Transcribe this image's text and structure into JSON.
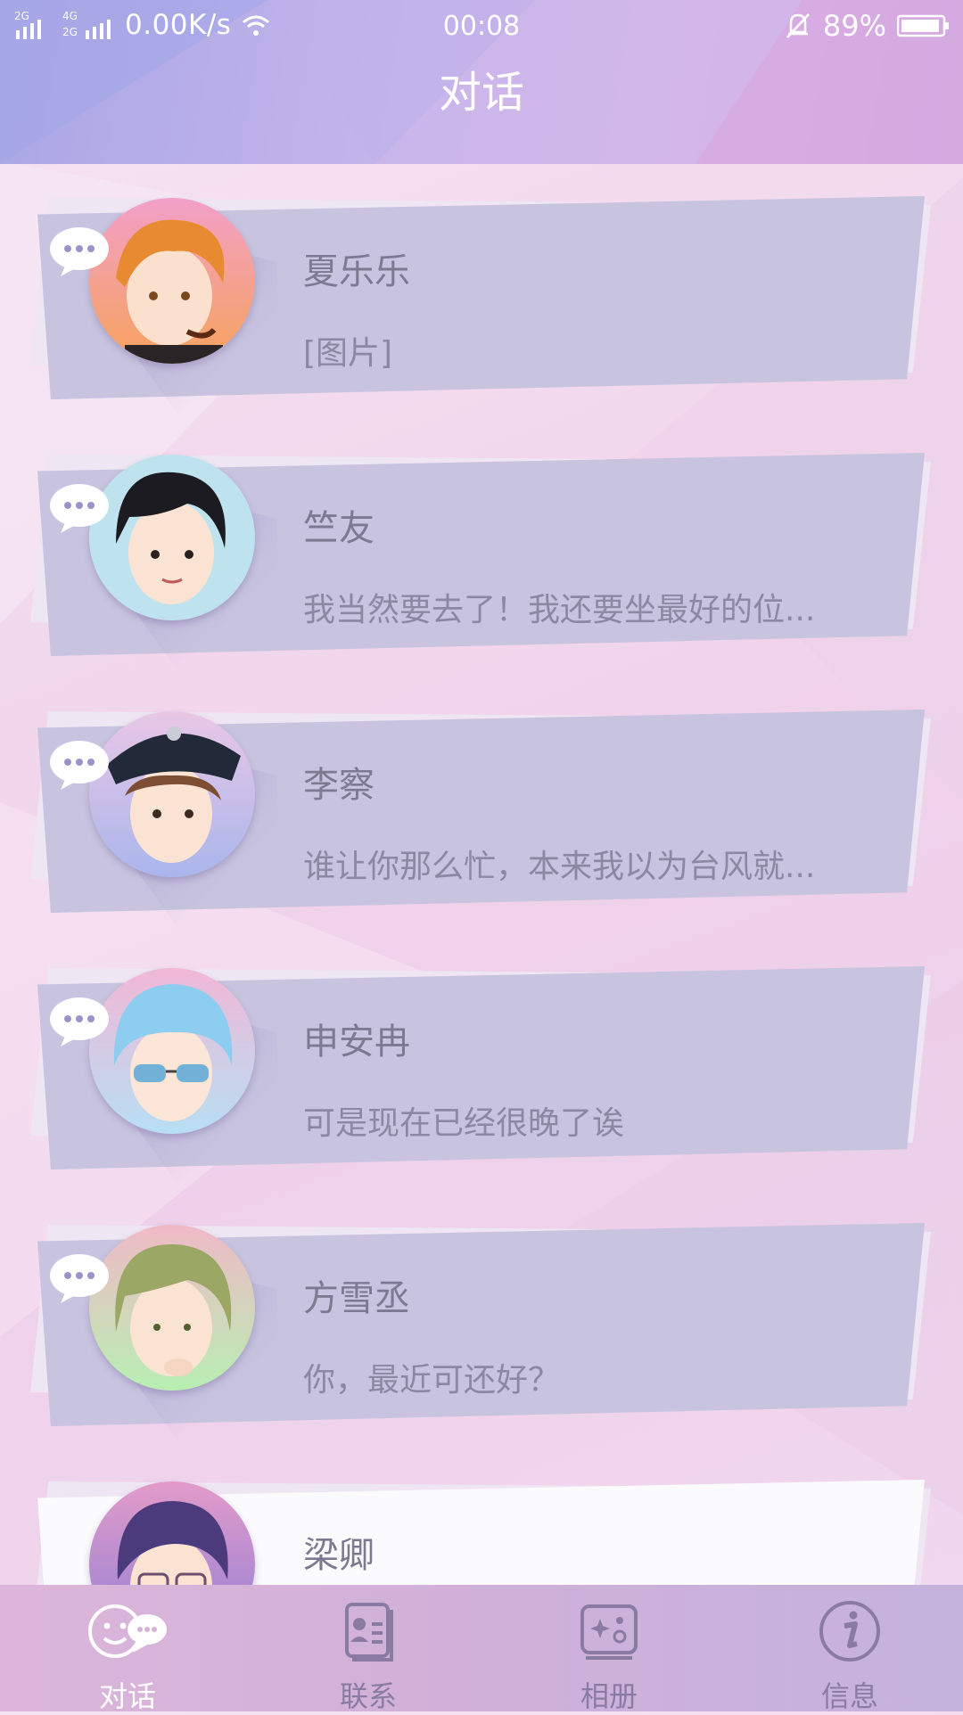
{
  "status_bar": {
    "network": "2G 4G",
    "speed": "0.00K/s",
    "time": "00:08",
    "battery": "89%",
    "icons": [
      "signal-icon",
      "wifi-icon",
      "bell-muted-icon",
      "battery-icon"
    ]
  },
  "header": {
    "title": "对话"
  },
  "conversations": [
    {
      "name": "夏乐乐",
      "message": "[图片]",
      "avatar": "orange-hair-boy"
    },
    {
      "name": "竺友",
      "message": "我当然要去了！我还要坐最好的位...",
      "avatar": "black-hair-boy"
    },
    {
      "name": "李察",
      "message": "谁让你那么忙，本来我以为台风就...",
      "avatar": "police-cap-boy"
    },
    {
      "name": "申安冉",
      "message": "可是现在已经很晚了诶",
      "avatar": "blue-hair-boy"
    },
    {
      "name": "方雪丞",
      "message": "你，最近可还好？",
      "avatar": "green-hair-boy"
    },
    {
      "name": "梁卿",
      "message": "",
      "avatar": "purple-hair-boy"
    }
  ],
  "nav": {
    "items": [
      {
        "label": "对话",
        "icon": "chat-icon",
        "active": true
      },
      {
        "label": "联系",
        "icon": "contacts-icon",
        "active": false
      },
      {
        "label": "相册",
        "icon": "album-icon",
        "active": false
      },
      {
        "label": "信息",
        "icon": "info-icon",
        "active": false
      }
    ]
  },
  "colors": {
    "header": "#b9aee8",
    "card": "#c8c4df",
    "nav": "#d3b3da",
    "text": "#7d7991"
  }
}
